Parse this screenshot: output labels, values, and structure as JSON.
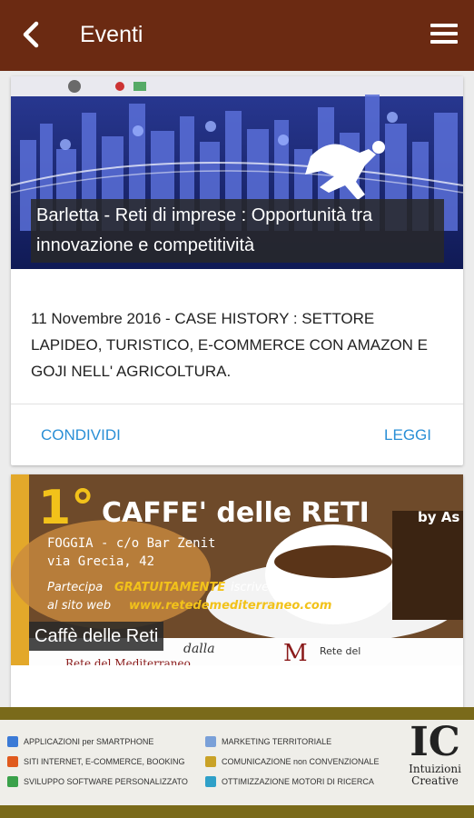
{
  "appbar": {
    "title": "Eventi",
    "back_icon": "chevron-left-icon",
    "menu_icon": "hamburger-menu-icon",
    "bg": "#6b2a12"
  },
  "events": [
    {
      "title": "Barletta - Reti di imprese : Opportunità tra innovazione e competitività",
      "description": "11 Novembre 2016 - CASE HISTORY : SETTORE LAPIDEO, TURISTICO, E-COMMERCE CON AMAZON E GOJI NELL' AGRICOLTURA.",
      "share_label": "CONDIVIDI",
      "read_label": "LEGGI"
    },
    {
      "title": "Caffè delle Reti",
      "poster": {
        "number": "1°",
        "headline": "CAFFE' delle RETI",
        "by": "by As",
        "place": "FOGGIA - c/o Bar Zenit",
        "street": "via Grecia, 42",
        "promo_a": "Partecipa",
        "promo_b": "GRATUITAMENTE",
        "promo_c": "iscrivendo la tua azienda",
        "promo_d": "al sito web",
        "site": "www.retedemediterraneo.com",
        "dalla": "dalla",
        "rete": "Rete del Mediterraneo",
        "logo_text": "Rete del"
      }
    }
  ],
  "footer": {
    "services_left": [
      "APPLICAZIONI per SMARTPHONE",
      "SITI INTERNET, E-COMMERCE, BOOKING",
      "SVILUPPO SOFTWARE PERSONALIZZATO"
    ],
    "services_right": [
      "MARKETING TERRITORIALE",
      "COMUNICAZIONE non CONVENZIONALE",
      "OTTIMIZZAZIONE MOTORI DI RICERCA"
    ],
    "logo_mark": "IC",
    "logo_line1": "Intuizioni",
    "logo_line2": "Creative",
    "accent": "#7a6a1a"
  },
  "link_color": "#2a8fd6"
}
